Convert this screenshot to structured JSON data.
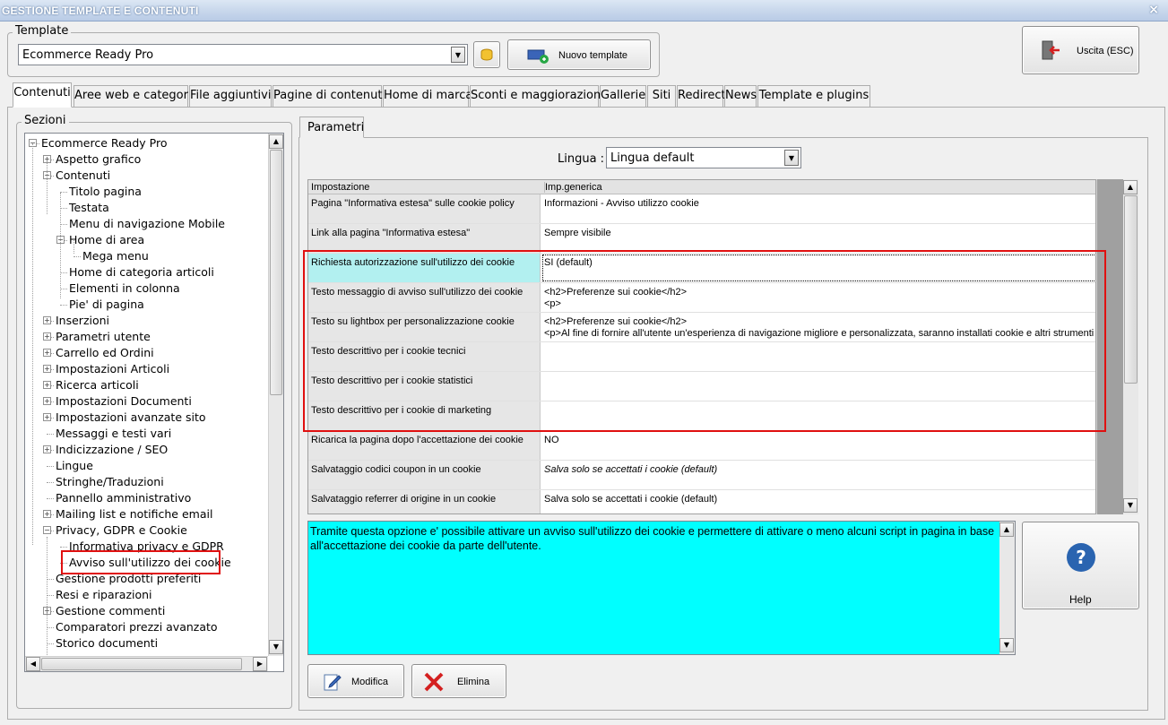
{
  "window": {
    "title": "GESTIONE TEMPLATE E CONTENUTI",
    "close": "×"
  },
  "template": {
    "label": "Template",
    "value": "Ecommerce Ready Pro",
    "new_button": "Nuovo template"
  },
  "exit_button": "Uscita (ESC)",
  "tabs": [
    "Contenuti",
    "Aree web e categorie",
    "File aggiuntivi",
    "Pagine di contenuti",
    "Home di marca",
    "Sconti e maggiorazioni",
    "Gallerie",
    "Siti",
    "Redirect",
    "News",
    "Template e plugins"
  ],
  "sections": {
    "label": "Sezioni",
    "tree": [
      {
        "label": "Ecommerce Ready Pro",
        "level": 0,
        "exp": "-"
      },
      {
        "label": "Aspetto grafico",
        "level": 1,
        "exp": "+"
      },
      {
        "label": "Contenuti",
        "level": 1,
        "exp": "-"
      },
      {
        "label": "Titolo pagina",
        "level": 2,
        "exp": ""
      },
      {
        "label": "Testata",
        "level": 2,
        "exp": ""
      },
      {
        "label": "Menu di navigazione Mobile",
        "level": 2,
        "exp": ""
      },
      {
        "label": "Home di area",
        "level": 2,
        "exp": "-"
      },
      {
        "label": "Mega menu",
        "level": 3,
        "exp": ""
      },
      {
        "label": "Home di categoria articoli",
        "level": 2,
        "exp": ""
      },
      {
        "label": "Elementi in colonna",
        "level": 2,
        "exp": ""
      },
      {
        "label": "Pie' di pagina",
        "level": 2,
        "exp": ""
      },
      {
        "label": "Inserzioni",
        "level": 1,
        "exp": "+"
      },
      {
        "label": "Parametri utente",
        "level": 1,
        "exp": "+"
      },
      {
        "label": "Carrello ed Ordini",
        "level": 1,
        "exp": "+"
      },
      {
        "label": "Impostazioni Articoli",
        "level": 1,
        "exp": "+"
      },
      {
        "label": "Ricerca articoli",
        "level": 1,
        "exp": "+"
      },
      {
        "label": "Impostazioni Documenti",
        "level": 1,
        "exp": "+"
      },
      {
        "label": "Impostazioni avanzate sito",
        "level": 1,
        "exp": "+"
      },
      {
        "label": "Messaggi e testi vari",
        "level": 1,
        "exp": ""
      },
      {
        "label": "Indicizzazione / SEO",
        "level": 1,
        "exp": "+"
      },
      {
        "label": "Lingue",
        "level": 1,
        "exp": ""
      },
      {
        "label": "Stringhe/Traduzioni",
        "level": 1,
        "exp": ""
      },
      {
        "label": "Pannello amministrativo",
        "level": 1,
        "exp": ""
      },
      {
        "label": "Mailing list e notifiche email",
        "level": 1,
        "exp": "+"
      },
      {
        "label": "Privacy, GDPR e Cookie",
        "level": 1,
        "exp": "-"
      },
      {
        "label": "Informativa privacy e GDPR",
        "level": 2,
        "exp": ""
      },
      {
        "label": "Avviso sull'utilizzo dei cookie",
        "level": 2,
        "exp": "",
        "selected": true
      },
      {
        "label": "Gestione prodotti preferiti",
        "level": 1,
        "exp": ""
      },
      {
        "label": "Resi e riparazioni",
        "level": 1,
        "exp": ""
      },
      {
        "label": "Gestione commenti",
        "level": 1,
        "exp": "+"
      },
      {
        "label": "Comparatori prezzi avanzato",
        "level": 1,
        "exp": ""
      },
      {
        "label": "Storico documenti",
        "level": 1,
        "exp": ""
      }
    ]
  },
  "params": {
    "tab": "Parametri",
    "lang_label": "Lingua :",
    "lang_value": "Lingua default",
    "headers": [
      "Impostazione",
      "Imp.generica"
    ],
    "rows": [
      {
        "name": "Pagina \"Informativa estesa\" sulle cookie policy",
        "value": "Informazioni - Avviso utilizzo cookie"
      },
      {
        "name": "Link alla pagina \"Informativa estesa\"",
        "value": "Sempre visibile"
      },
      {
        "name": "Richiesta autorizzazione sull'utilizzo dei cookie",
        "value": "SI (default)",
        "selected": true
      },
      {
        "name": "Testo messaggio di avviso sull'utilizzo dei cookie",
        "value": "<h2>Preferenze sui cookie</h2>\n<p>"
      },
      {
        "name": "Testo su lightbox per personalizzazione cookie",
        "value": "<h2>Preferenze sui cookie</h2>\n<p>Al fine di fornire all'utente un'esperienza di navigazione migliore e personalizzata, saranno installati cookie e altri strumenti"
      },
      {
        "name": "Testo descrittivo per i cookie tecnici",
        "value": ""
      },
      {
        "name": "Testo descrittivo per i cookie statistici",
        "value": ""
      },
      {
        "name": "Testo descrittivo per i cookie di marketing",
        "value": ""
      },
      {
        "name": "Ricarica la pagina dopo l'accettazione dei cookie",
        "value": "NO"
      },
      {
        "name": "Salvataggio codici coupon in un cookie",
        "value": "Salva solo se accettati i cookie (default)",
        "italic": true
      },
      {
        "name": "Salvataggio referrer di origine in un cookie",
        "value": "Salva solo se accettati i cookie (default)"
      }
    ]
  },
  "description": "Tramite questa opzione e' possibile attivare un avviso sull'utilizzo dei cookie e permettere di attivare o meno alcuni script in pagina in base all'accettazione dei cookie da parte dell'utente.",
  "buttons": {
    "help": "Help",
    "modifica": "Modifica",
    "elimina": "Elimina"
  },
  "colors": {
    "highlight": "#e01010",
    "desc_bg": "#00ffff",
    "selected_cell": "#b2f0f0"
  }
}
